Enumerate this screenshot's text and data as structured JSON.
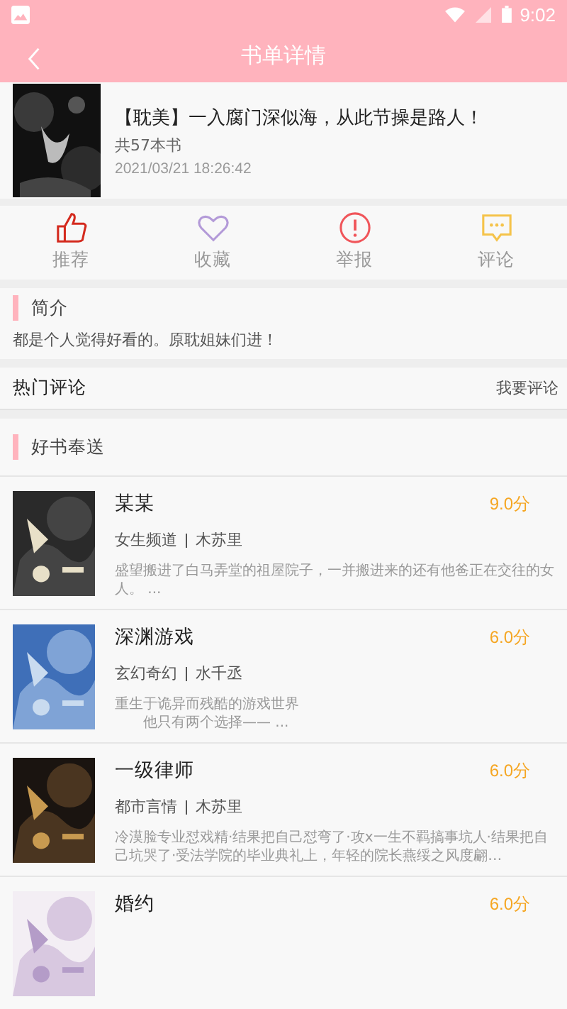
{
  "status_bar": {
    "time": "9:02"
  },
  "header": {
    "title": "书单详情"
  },
  "booklist": {
    "title": "【耽美】一入腐门深似海，从此节操是路人！",
    "count": "共57本书",
    "date": "2021/03/21 18:26:42"
  },
  "actions": [
    {
      "kind": "like",
      "label": "推荐"
    },
    {
      "kind": "favorite",
      "label": "收藏"
    },
    {
      "kind": "report",
      "label": "举报"
    },
    {
      "kind": "comment",
      "label": "评论"
    }
  ],
  "intro": {
    "heading": "简介",
    "text": "都是个人觉得好看的。原耽姐妹们进！"
  },
  "hot_comments": {
    "heading": "热门评论",
    "action": "我要评论"
  },
  "recommend": {
    "heading": "好书奉送",
    "books": [
      {
        "title": "某某",
        "score": "9.0分",
        "category": "女生频道",
        "author": "木苏里",
        "summary": "盛望搬进了白马弄堂的祖屋院子，一并搬进来的还有他爸正在交往的女人。 ..."
      },
      {
        "title": "深渊游戏",
        "score": "6.0分",
        "category": "玄幻奇幻",
        "author": "水千丞",
        "summary": "重生于诡异而残酷的游戏世界",
        "summary_indented": "他只有两个选择—— ..."
      },
      {
        "title": "一级律师",
        "score": "6.0分",
        "category": "都市言情",
        "author": "木苏里",
        "summary": "冷漠脸专业怼戏精·结果把自己怼弯了·攻x一生不羁搞事坑人·结果把自己坑哭了·受法学院的毕业典礼上，年轻的院长燕绥之风度翩…"
      },
      {
        "title": "婚约",
        "score": "6.0分"
      }
    ]
  }
}
